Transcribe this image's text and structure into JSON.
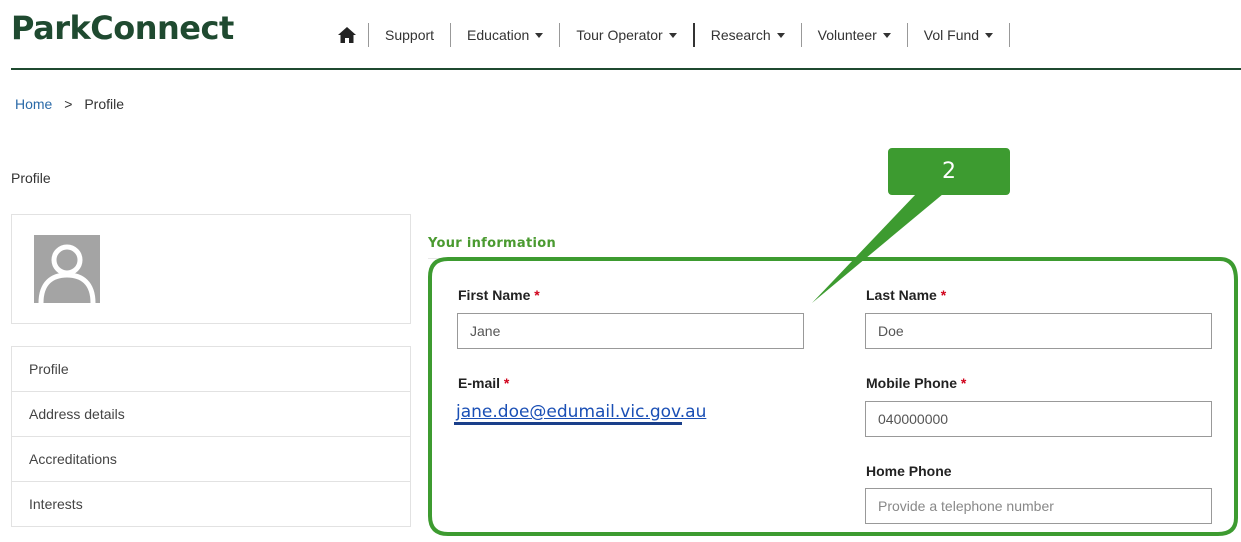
{
  "brand": {
    "name": "ParkConnect"
  },
  "nav": {
    "items": [
      {
        "label": "Support",
        "has_dropdown": false
      },
      {
        "label": "Education",
        "has_dropdown": true
      },
      {
        "label": "Tour Operator",
        "has_dropdown": true
      },
      {
        "label": "Research",
        "has_dropdown": true
      },
      {
        "label": "Volunteer",
        "has_dropdown": true
      },
      {
        "label": "Vol Fund",
        "has_dropdown": true
      }
    ],
    "home_icon": "home-icon"
  },
  "breadcrumb": {
    "home": "Home",
    "separator": ">",
    "current": "Profile"
  },
  "page": {
    "title": "Profile"
  },
  "sidebar": {
    "avatar_icon": "user-placeholder-icon",
    "items": [
      {
        "label": "Profile"
      },
      {
        "label": "Address details"
      },
      {
        "label": "Accreditations"
      },
      {
        "label": "Interests"
      }
    ]
  },
  "form": {
    "section_title": "Your information",
    "required_marker": "*",
    "first_name": {
      "label": "First Name",
      "value": "Jane"
    },
    "last_name": {
      "label": "Last Name",
      "value": "Doe"
    },
    "email": {
      "label": "E-mail",
      "value": "jane.doe@edumail.vic.gov.au"
    },
    "mobile_phone": {
      "label": "Mobile Phone",
      "value": "040000000"
    },
    "home_phone": {
      "label": "Home Phone",
      "value": "",
      "placeholder": "Provide a telephone number"
    }
  },
  "annotation": {
    "number": "2"
  },
  "colors": {
    "brand_green": "#1f4a30",
    "accent_green": "#3d9b30",
    "required_red": "#d0021b",
    "link_blue": "#1a4fb5"
  }
}
